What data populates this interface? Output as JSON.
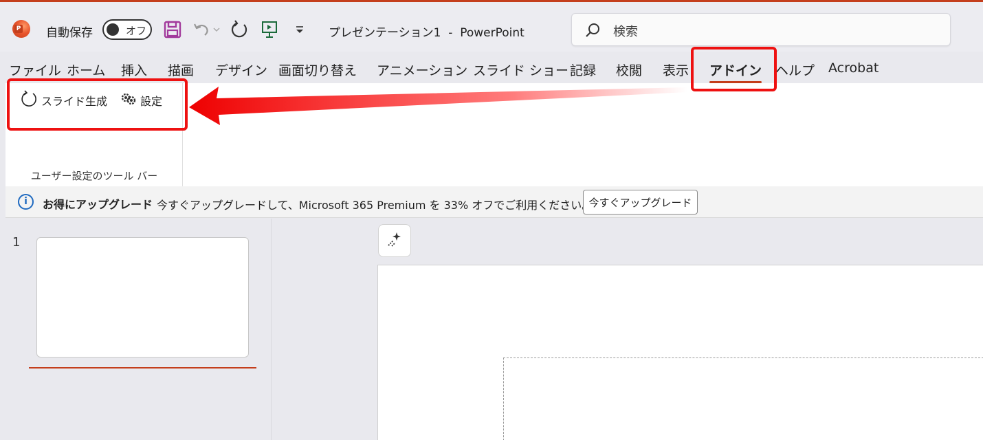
{
  "titlebar": {
    "autosave_label": "自動保存",
    "autosave_toggle": "オフ",
    "doc_title": "プレゼンテーション1  -  PowerPoint",
    "search_placeholder": "検索"
  },
  "tabs": [
    "ファイル",
    "ホーム",
    "挿入",
    "描画",
    "デザイン",
    "画面切り替え",
    "アニメーション",
    "スライド ショー",
    "記録",
    "校閲",
    "表示",
    "アドイン",
    "ヘルプ",
    "Acrobat"
  ],
  "active_tab": "アドイン",
  "ribbon": {
    "generate_label": "スライド生成",
    "settings_label": "設定",
    "group_label": "ユーザー設定のツール バー"
  },
  "notice": {
    "title": "お得にアップグレード",
    "message": "今すぐアップグレードして、Microsoft 365 Premium を 33% オフでご利用ください。",
    "button": "今すぐアップグレード"
  },
  "slides": {
    "number": "1"
  },
  "colors": {
    "accent": "#c43e1c",
    "annotation": "#ee1111",
    "info": "#1f6ac0"
  }
}
